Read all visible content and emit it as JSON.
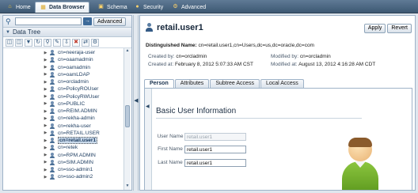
{
  "tabs": [
    {
      "label": "Home",
      "icon": "home-icon"
    },
    {
      "label": "Data Browser",
      "icon": "data-browser-icon",
      "active": true
    },
    {
      "label": "Schema",
      "icon": "schema-icon"
    },
    {
      "label": "Security",
      "icon": "security-icon"
    },
    {
      "label": "Advanced",
      "icon": "advanced-icon"
    }
  ],
  "search": {
    "value": "",
    "advanced_label": "Advanced"
  },
  "tree": {
    "title": "Data Tree",
    "items": [
      "cn=neeraja-user",
      "cn=oaamadmin",
      "cn=oamadmin",
      "cn=oamLDAP",
      "cn=orcladmin",
      "cn=PolicyROUser",
      "cn=PolicyRWUser",
      "cn=PUBLIC",
      "cn=REIM.ADMIN",
      "cn=rekha-admin",
      "cn=rekha-user",
      "cn=RETAIL.USER",
      "cn=retail.user1",
      "cn=retek",
      "cn=RPM.ADMIN",
      "cn=SIM.ADMIN",
      "cn=sso-admin1",
      "cn=sso-admin2"
    ],
    "selected_index": 12
  },
  "entry": {
    "title": "retail.user1",
    "apply_label": "Apply",
    "revert_label": "Revert",
    "dn_label": "Distinguished Name:",
    "dn_value": "cn=retail.user1,cn=Users,dc=us,dc=oracle,dc=com",
    "created_by_label": "Created by:",
    "created_by_value": "cn=orcladmin",
    "modified_by_label": "Modified by:",
    "modified_by_value": "cn=orcladmin",
    "created_at_label": "Created at:",
    "created_at_value": "February 8, 2012 5:07:33 AM CST",
    "modified_at_label": "Modified at:",
    "modified_at_value": "August 13, 2012 4:16:28 AM CDT"
  },
  "subtabs": [
    "Person",
    "Attributes",
    "Subtree Access",
    "Local Access"
  ],
  "form": {
    "section_title": "Basic User Information",
    "user_name_label": "User Name",
    "user_name_value": "retail.user1",
    "first_name_label": "First Name",
    "first_name_value": "retail.user1",
    "last_name_label": "Last Name",
    "last_name_value": "retail.user1"
  }
}
